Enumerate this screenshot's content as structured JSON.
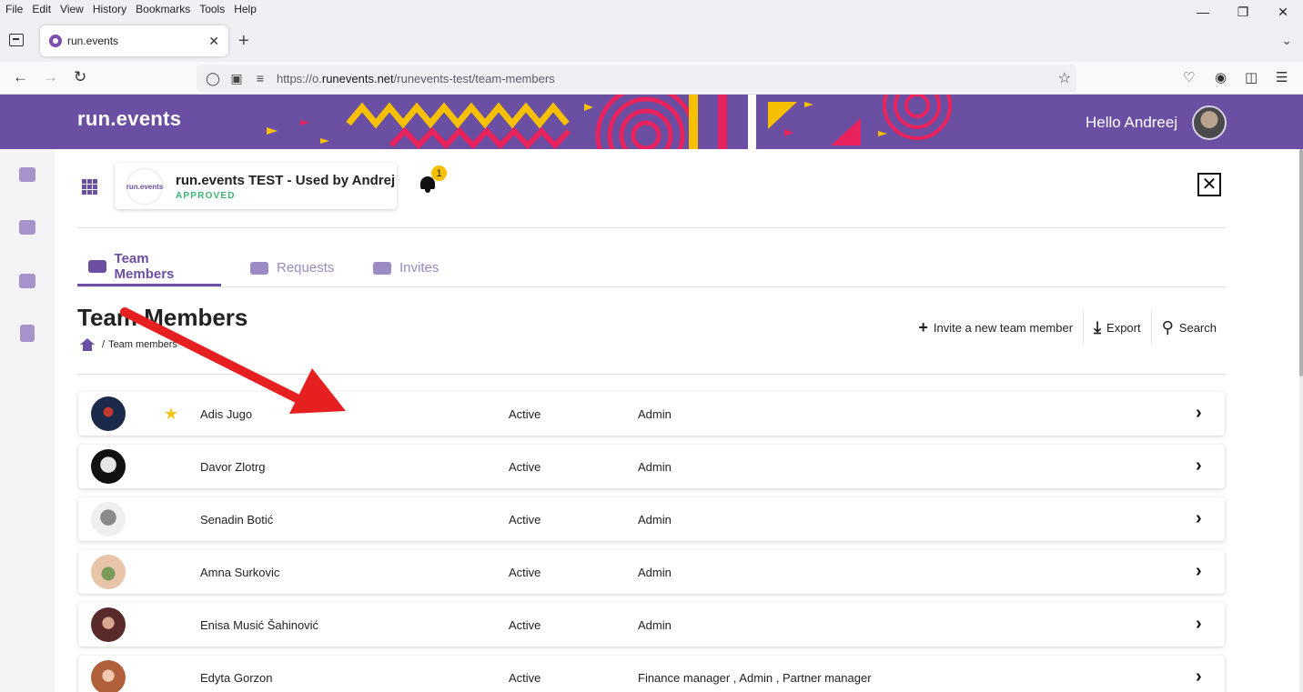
{
  "browser": {
    "menu": [
      "File",
      "Edit",
      "View",
      "History",
      "Bookmarks",
      "Tools",
      "Help"
    ],
    "tab_title": "run.events",
    "url_prefix": "https://o.",
    "url_domain": "runevents.net",
    "url_path": "/runevents-test/team-members"
  },
  "header": {
    "logo": "run.events",
    "greeting": "Hello Andreej",
    "brand_color": "#6a4fa3"
  },
  "org": {
    "name": "run.events TEST - Used by Andrej",
    "status": "APPROVED",
    "logo_text": "run.events",
    "notification_count": "1"
  },
  "tabs": [
    {
      "label": "Team Members",
      "icon": "people-icon"
    },
    {
      "label": "Requests",
      "icon": "chat-icon"
    },
    {
      "label": "Invites",
      "icon": "card-icon"
    }
  ],
  "page": {
    "title": "Team Members",
    "breadcrumb_separator": "/",
    "breadcrumb": "Team members"
  },
  "actions": {
    "invite": "Invite a new team member",
    "export": "Export",
    "search": "Search"
  },
  "members": [
    {
      "name": "Adis Jugo",
      "status": "Active",
      "roles": "Admin",
      "favorite": true
    },
    {
      "name": "Davor Zlotrg",
      "status": "Active",
      "roles": "Admin",
      "favorite": false
    },
    {
      "name": "Senadin Botić",
      "status": "Active",
      "roles": "Admin",
      "favorite": false
    },
    {
      "name": "Amna Surkovic",
      "status": "Active",
      "roles": "Admin",
      "favorite": false
    },
    {
      "name": "Enisa Musić Šahinović",
      "status": "Active",
      "roles": "Admin",
      "favorite": false
    },
    {
      "name": "Edyta Gorzon",
      "status": "Active",
      "roles": "Finance manager , Admin , Partner manager",
      "favorite": false
    }
  ]
}
